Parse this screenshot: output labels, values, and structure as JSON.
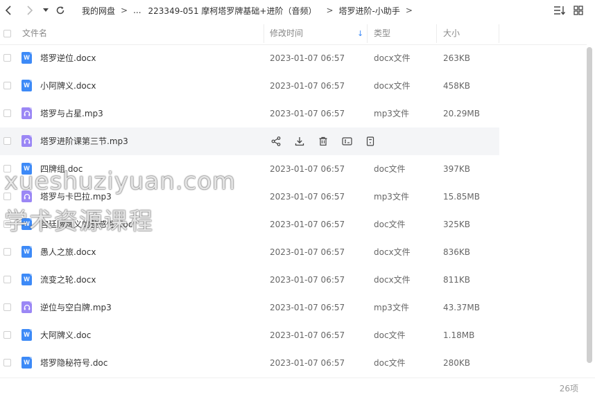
{
  "nav": {
    "back_icon": "chevron-left-icon",
    "forward_icon": "chevron-right-icon",
    "dropdown_icon": "caret-down-icon",
    "refresh_icon": "refresh-icon"
  },
  "breadcrumb": {
    "root": "我的网盘",
    "ellipsis": "...",
    "parent": "223349-051 摩柯塔罗牌基础+进阶（音频）",
    "current": "塔罗进阶-小助手",
    "separator": ">"
  },
  "toolbar": {
    "sort_icon": "sort-list-icon",
    "view_icon": "grid-view-icon"
  },
  "table": {
    "headers": {
      "name": "文件名",
      "modified": "修改时间",
      "type": "类型",
      "size": "大小"
    },
    "sort_arrow": "↓",
    "rows": [
      {
        "name": "塔罗逆位.docx",
        "modified": "2023-01-07 06:57",
        "type": "docx文件",
        "size": "263KB",
        "icon": "word"
      },
      {
        "name": "小阿牌义.docx",
        "modified": "2023-01-07 06:57",
        "type": "docx文件",
        "size": "458KB",
        "icon": "word"
      },
      {
        "name": "塔罗与占星.mp3",
        "modified": "2023-01-07 06:57",
        "type": "mp3文件",
        "size": "20.29MB",
        "icon": "audio"
      },
      {
        "name": "塔罗进阶课第三节.mp3",
        "modified": "",
        "type": "",
        "size": "",
        "icon": "audio",
        "hovered": true
      },
      {
        "name": "四牌组.doc",
        "modified": "2023-01-07 06:57",
        "type": "doc文件",
        "size": "397KB",
        "icon": "word"
      },
      {
        "name": "塔罗与卡巴拉.mp3",
        "modified": "2023-01-07 06:57",
        "type": "mp3文件",
        "size": "15.85MB",
        "icon": "audio"
      },
      {
        "name": "宫廷牌牌义的整感性.doc",
        "modified": "2023-01-07 06:57",
        "type": "doc文件",
        "size": "325KB",
        "icon": "word"
      },
      {
        "name": "愚人之旅.docx",
        "modified": "2023-01-07 06:57",
        "type": "docx文件",
        "size": "836KB",
        "icon": "word"
      },
      {
        "name": "流变之轮.docx",
        "modified": "2023-01-07 06:57",
        "type": "docx文件",
        "size": "811KB",
        "icon": "word"
      },
      {
        "name": "逆位与空白牌.mp3",
        "modified": "2023-01-07 06:57",
        "type": "mp3文件",
        "size": "43.37MB",
        "icon": "audio"
      },
      {
        "name": "大阿牌义.doc",
        "modified": "2023-01-07 06:57",
        "type": "doc文件",
        "size": "1.18MB",
        "icon": "word"
      },
      {
        "name": "塔罗隐秘符号.doc",
        "modified": "2023-01-07 06:57",
        "type": "doc文件",
        "size": "280KB",
        "icon": "word"
      }
    ],
    "row_actions": [
      "share-icon",
      "download-icon",
      "delete-icon",
      "rename-icon",
      "more-icon"
    ]
  },
  "footer": {
    "count": "26项"
  },
  "watermark": {
    "line1": "xueshuziyuan.com",
    "line2": "学术资源课程"
  },
  "colors": {
    "word_icon": "#3d8af7",
    "audio_icon": "#9b87f5",
    "accent": "#3d8af7"
  }
}
